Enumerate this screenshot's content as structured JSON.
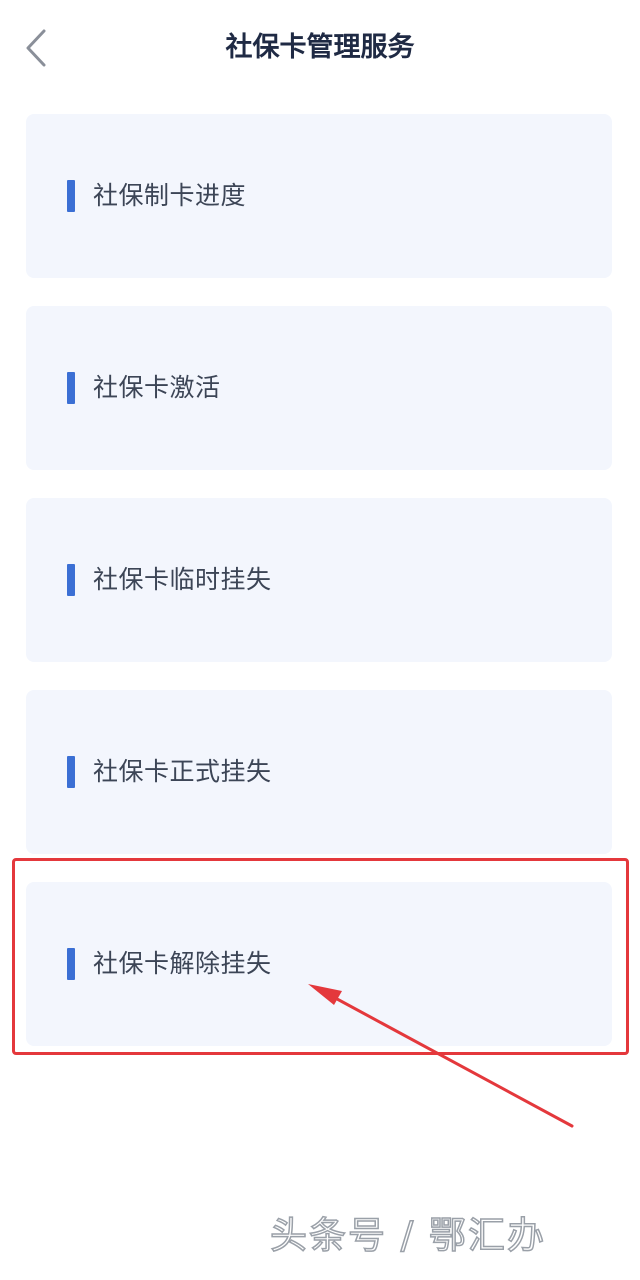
{
  "header": {
    "title": "社保卡管理服务",
    "back_icon": "chevron-left-icon"
  },
  "menu": {
    "items": [
      {
        "label": "社保制卡进度"
      },
      {
        "label": "社保卡激活"
      },
      {
        "label": "社保卡临时挂失"
      },
      {
        "label": "社保卡正式挂失"
      },
      {
        "label": "社保卡解除挂失"
      }
    ]
  },
  "annotation": {
    "highlight_color": "#e4383c",
    "highlighted_item": "社保卡解除挂失"
  },
  "watermark": {
    "text": "头条号 / 鄂汇办"
  },
  "colors": {
    "accent": "#3b6fd4",
    "card_background": "#f3f6fd",
    "title_text": "#1f2a44"
  }
}
